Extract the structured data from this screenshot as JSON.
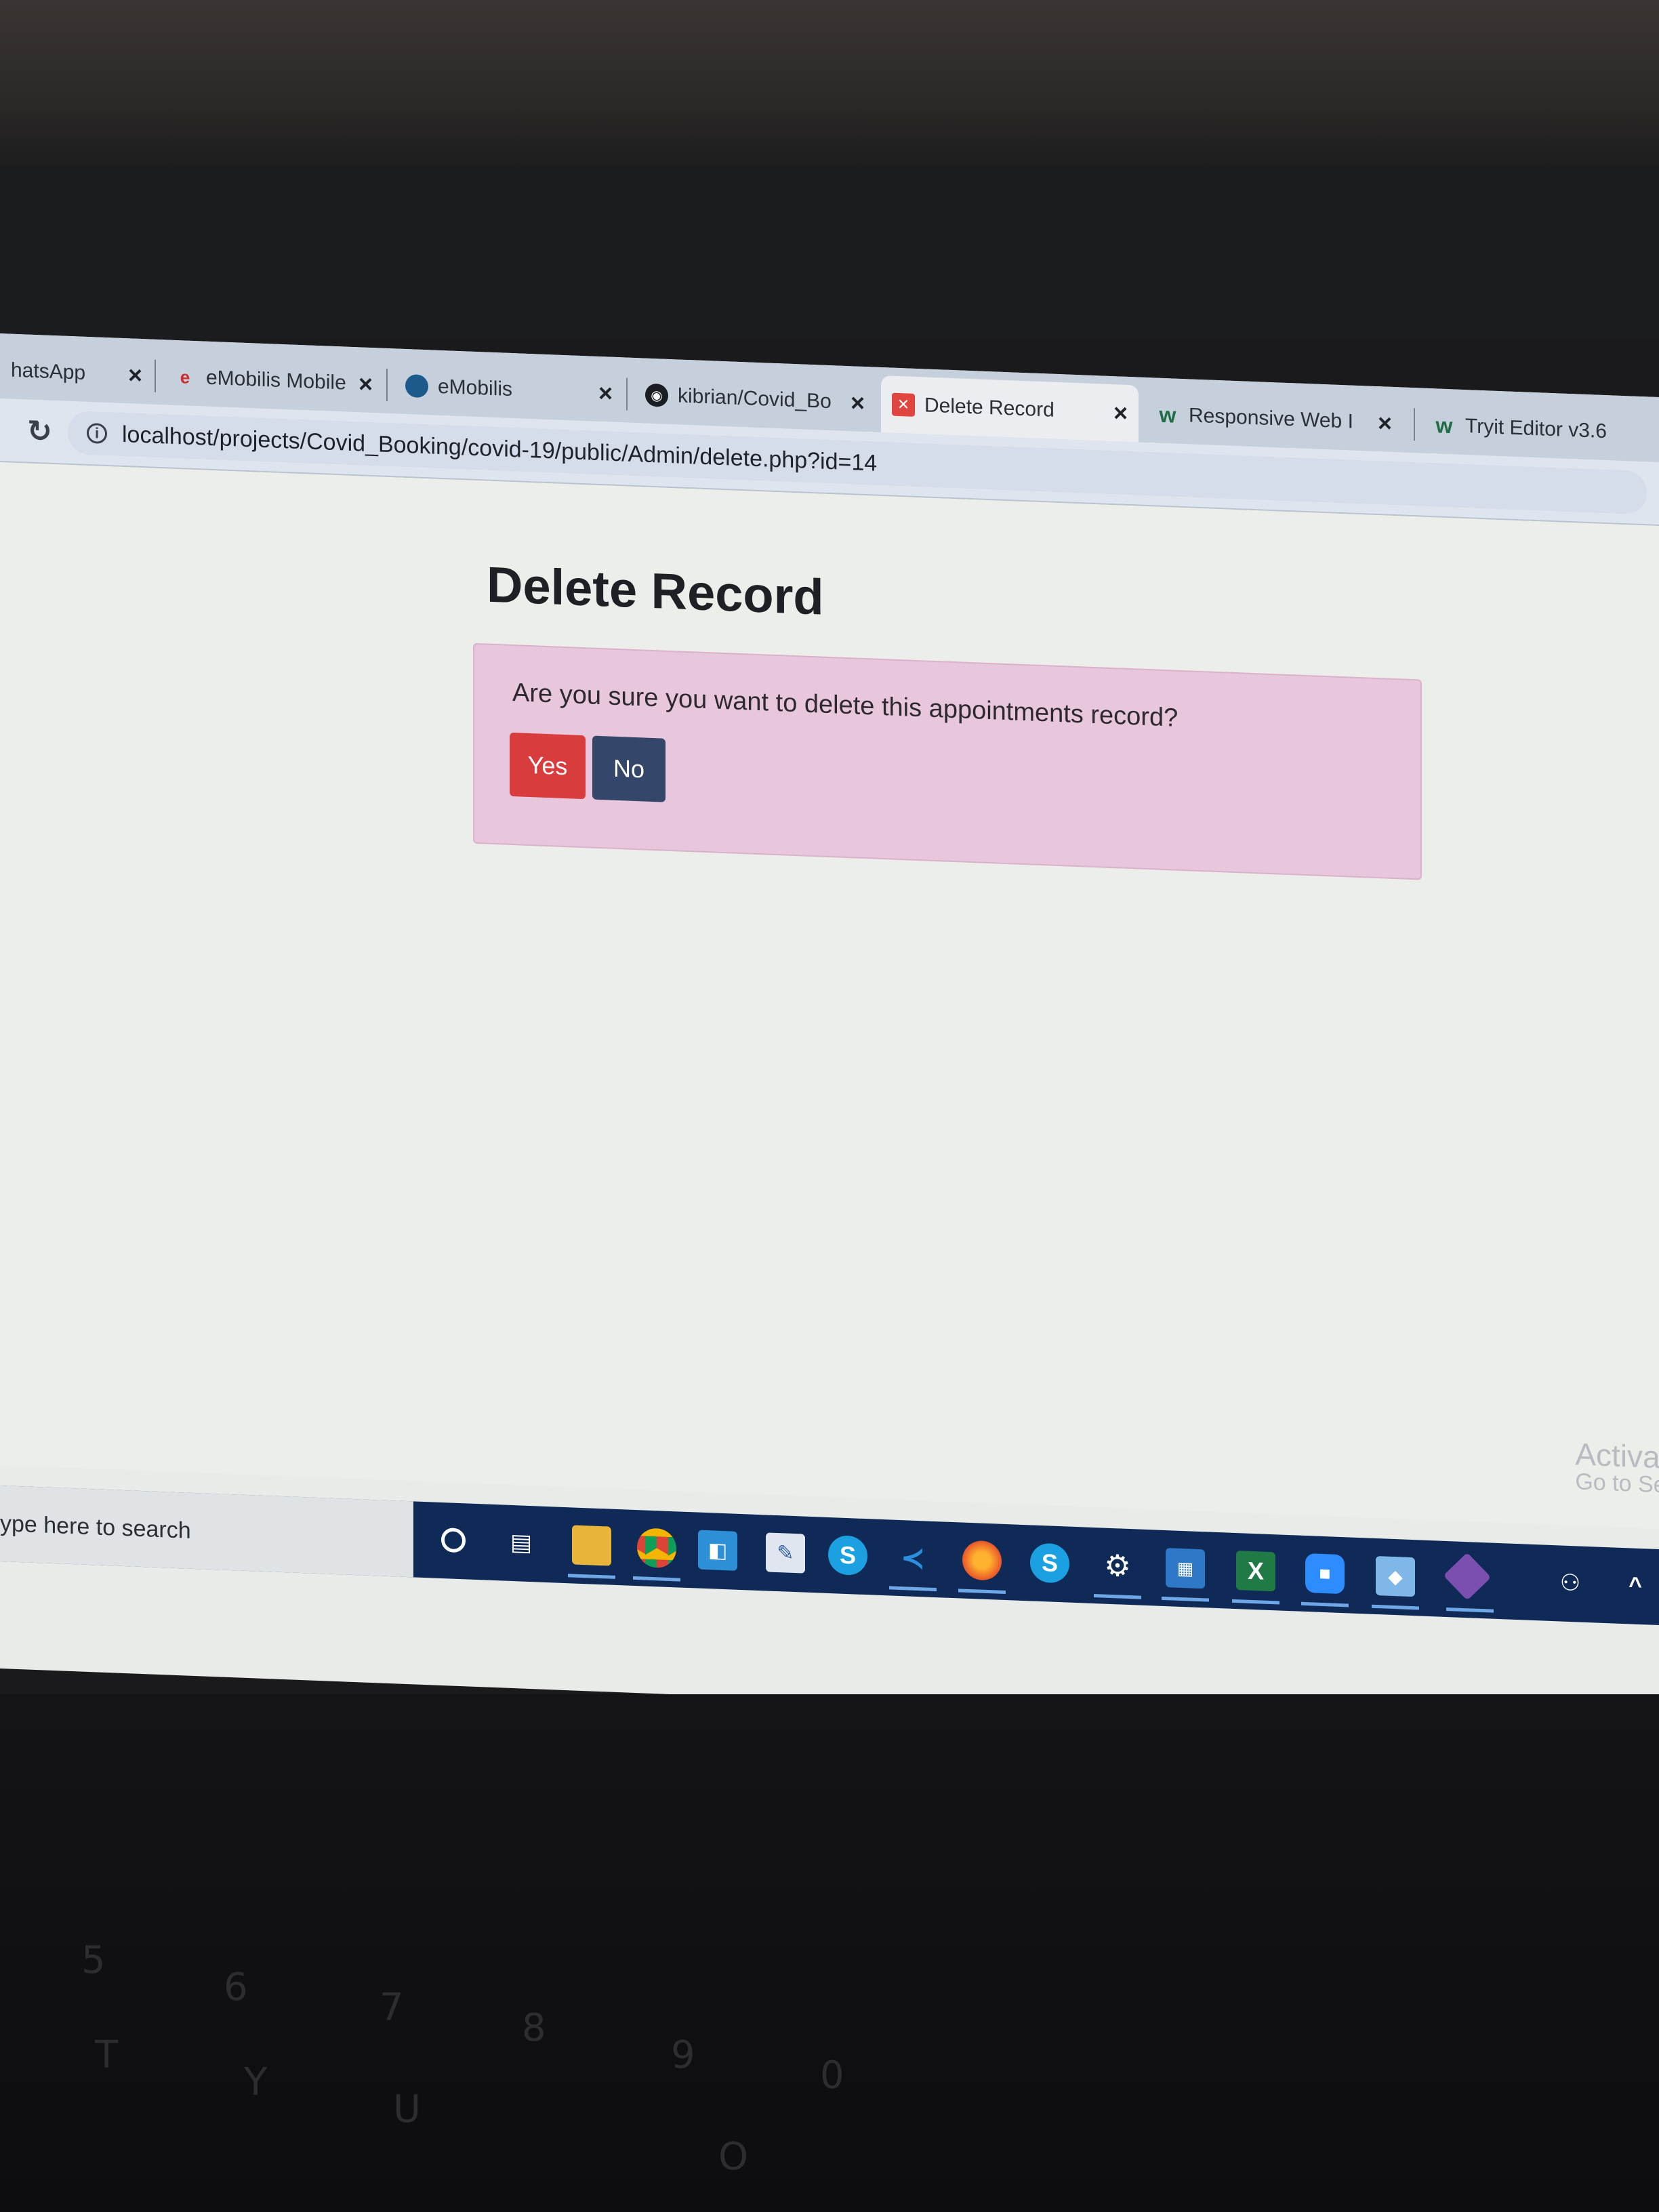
{
  "browser": {
    "tabs": [
      {
        "label": "hatsApp",
        "active": false
      },
      {
        "label": "eMobilis Mobile T",
        "active": false
      },
      {
        "label": "eMobilis",
        "active": false
      },
      {
        "label": "kibrian/Covid_Bo",
        "active": false
      },
      {
        "label": "Delete Record",
        "active": true
      },
      {
        "label": "Responsive Web I",
        "active": false
      },
      {
        "label": "Tryit Editor v3.6",
        "active": false
      }
    ],
    "close_glyph": "×",
    "address": "localhost/projects/Covid_Booking/covid-19/public/Admin/delete.php?id=14"
  },
  "page": {
    "title": "Delete Record",
    "alert_message": "Are you sure you want to delete this appointments record?",
    "yes_label": "Yes",
    "no_label": "No"
  },
  "taskbar": {
    "search_placeholder": "ype here to search",
    "activate_line1": "Activate",
    "activate_line2": "Go to Sett"
  },
  "colors": {
    "yes_button": "#d93c3c",
    "no_button": "#35466b",
    "alert_background": "#e8c6dc",
    "taskbar": "#0f2a56"
  },
  "icons": [
    "cortana-icon",
    "task-view-icon",
    "file-explorer-icon",
    "chrome-icon",
    "app-icon",
    "paint-icon",
    "skype-icon",
    "vscode-icon",
    "firefox-icon",
    "skype-business-icon",
    "settings-icon",
    "outlook-icon",
    "excel-icon",
    "zoom-icon",
    "photos-icon",
    "gitkraken-icon",
    "people-icon",
    "chevron-up-icon"
  ]
}
